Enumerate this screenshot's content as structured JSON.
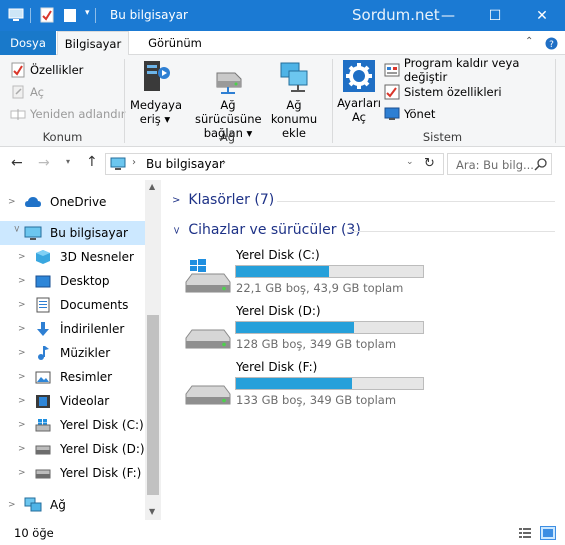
{
  "window": {
    "title": "Bu bilgisayar",
    "watermark": "Sordum.net",
    "minimize": "—",
    "maximize": "☐",
    "close": "✕"
  },
  "ribbon": {
    "tabs": [
      "Dosya",
      "Bilgisayar",
      "Görünüm"
    ],
    "konum": {
      "label": "Konum",
      "items": [
        "Özellikler",
        "Aç",
        "Yeniden adlandır"
      ]
    },
    "ag": {
      "label": "Ağ",
      "items": [
        {
          "line1": "Medyaya",
          "line2": "eriş ▾"
        },
        {
          "line1": "Ağ sürücüsüne",
          "line2": "bağlan ▾"
        },
        {
          "line1": "Ağ konumu",
          "line2": "ekle"
        }
      ]
    },
    "sistem": {
      "label": "Sistem",
      "big": {
        "line1": "Ayarları",
        "line2": "Aç"
      },
      "items": [
        "Program kaldır veya değiştir",
        "Sistem özellikleri",
        "Yönet"
      ]
    }
  },
  "address": {
    "path": "Bu bilgisayar",
    "search_placeholder": "Ara: Bu bilg..."
  },
  "nav": [
    {
      "label": "OneDrive",
      "icon": "onedrive-icon"
    },
    {
      "label": "Bu bilgisayar",
      "icon": "computer-icon"
    },
    {
      "label": "3D Nesneler",
      "icon": "3d-objects-icon"
    },
    {
      "label": "Desktop",
      "icon": "desktop-icon"
    },
    {
      "label": "Documents",
      "icon": "documents-icon"
    },
    {
      "label": "İndirilenler",
      "icon": "downloads-icon"
    },
    {
      "label": "Müzikler",
      "icon": "music-icon"
    },
    {
      "label": "Resimler",
      "icon": "pictures-icon"
    },
    {
      "label": "Videolar",
      "icon": "videos-icon"
    },
    {
      "label": "Yerel Disk (C:)",
      "icon": "drive-icon"
    },
    {
      "label": "Yerel Disk (D:)",
      "icon": "drive-icon"
    },
    {
      "label": "Yerel Disk (F:)",
      "icon": "drive-icon"
    },
    {
      "label": "Ağ",
      "icon": "network-icon"
    }
  ],
  "content": {
    "folders_header": "Klasörler (7)",
    "devices_header": "Cihazlar ve sürücüler (3)",
    "drives": [
      {
        "name": "Yerel Disk (C:)",
        "info": "22,1 GB boş, 43,9 GB toplam",
        "used_fraction": 0.497
      },
      {
        "name": "Yerel Disk (D:)",
        "info": "128 GB boş, 349 GB toplam",
        "used_fraction": 0.633
      },
      {
        "name": "Yerel Disk (F:)",
        "info": "133 GB boş, 349 GB toplam",
        "used_fraction": 0.619
      }
    ]
  },
  "status": {
    "count": "10 öğe"
  }
}
